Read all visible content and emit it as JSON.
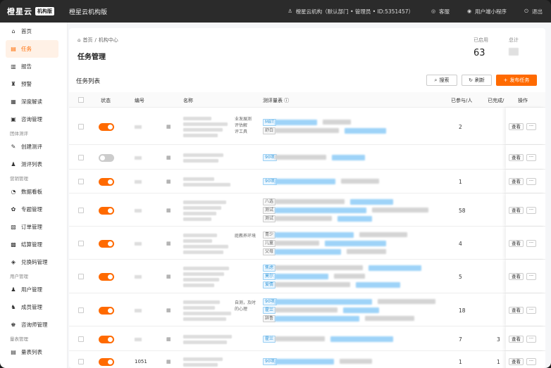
{
  "topbar": {
    "logo": "橙星云",
    "badge": "机构版",
    "org": "橙星云机构版",
    "user": "橙星云机构（默认部门 • 管理员 • ID:5351457）",
    "service": "客服",
    "mini": "用户端小程序",
    "logout": "退出"
  },
  "sidebar": {
    "items": [
      {
        "label": "首页",
        "icon": "home-icon",
        "glyph": "⌂"
      },
      {
        "label": "任务",
        "icon": "task-icon",
        "glyph": "▤",
        "active": true
      },
      {
        "label": "报告",
        "icon": "report-icon",
        "glyph": "▥"
      },
      {
        "label": "预警",
        "icon": "alert-icon",
        "glyph": "♜"
      },
      {
        "label": "深度解读",
        "icon": "book-icon",
        "glyph": "▦"
      },
      {
        "label": "咨询管理",
        "icon": "chat-icon",
        "glyph": "▣"
      }
    ],
    "group1": "团体测评",
    "items2": [
      {
        "label": "创建测评",
        "icon": "create-icon",
        "glyph": "✎"
      },
      {
        "label": "测评列表",
        "icon": "users-icon",
        "glyph": "♟"
      }
    ],
    "group2": "营销管理",
    "items3": [
      {
        "label": "数据看板",
        "icon": "dashboard-icon",
        "glyph": "◔"
      },
      {
        "label": "专题管理",
        "icon": "topic-icon",
        "glyph": "✿"
      },
      {
        "label": "订单管理",
        "icon": "order-icon",
        "glyph": "▧"
      },
      {
        "label": "结算管理",
        "icon": "settle-icon",
        "glyph": "▩"
      },
      {
        "label": "兑换码管理",
        "icon": "code-icon",
        "glyph": "◈"
      }
    ],
    "group3": "用户管理",
    "items4": [
      {
        "label": "用户管理",
        "icon": "user-icon",
        "glyph": "♟"
      },
      {
        "label": "成员管理",
        "icon": "member-icon",
        "glyph": "♞"
      },
      {
        "label": "咨询师管理",
        "icon": "counselor-icon",
        "glyph": "♚"
      }
    ],
    "group4": "量表管理",
    "items5": [
      {
        "label": "量表列表",
        "icon": "scale-icon",
        "glyph": "▤"
      }
    ]
  },
  "header": {
    "crumb_home": "首页",
    "crumb_sep": "/",
    "crumb_cur": "机构中心",
    "title": "任务管理",
    "stat1_label": "已启用",
    "stat1_value": "63",
    "stat2_label": "总计"
  },
  "list": {
    "title": "任务列表",
    "search": "搜索",
    "refresh": "刷新",
    "publish": "发布任务",
    "columns": {
      "status": "状态",
      "code": "编号",
      "name": "名称",
      "scale": "测评量表",
      "joined": "已参与/人",
      "done": "已完成/",
      "ops": "操作"
    },
    "view": "查看",
    "more": "···",
    "rows": [
      {
        "on": true,
        "joined": "2",
        "done": "",
        "name_frag": "业发展测",
        "name_frag2": "评估解",
        "name_frag3": "评工具",
        "tags": [
          "MBT",
          "舒白"
        ]
      },
      {
        "on": false,
        "joined": "",
        "done": "",
        "tags": [
          "90项"
        ]
      },
      {
        "on": true,
        "joined": "1",
        "done": "",
        "tags": [
          "90项"
        ]
      },
      {
        "on": true,
        "joined": "58",
        "done": "",
        "tags": [
          "八选",
          "测试",
          "测试"
        ]
      },
      {
        "on": true,
        "joined": "4",
        "done": "",
        "name_frag": "庭教养环境",
        "tags": [
          "青少",
          "儿童",
          "父母"
        ]
      },
      {
        "on": true,
        "joined": "5",
        "done": "",
        "tags": [
          "焦虑",
          "莫尔",
          "爱情"
        ]
      },
      {
        "on": true,
        "joined": "18",
        "done": "",
        "name_frag": "自测，及时",
        "name_frag2": "的心理",
        "tags": [
          "90项",
          "霍兰",
          "辞鲁"
        ]
      },
      {
        "on": true,
        "joined": "7",
        "done": "3",
        "tags": [
          "霍兰"
        ]
      },
      {
        "on": true,
        "joined": "1",
        "done": "1",
        "code": "1051",
        "tags": [
          "90项"
        ]
      }
    ]
  },
  "colors": {
    "accent": "#ff6a00",
    "link": "#3a9ad9"
  }
}
